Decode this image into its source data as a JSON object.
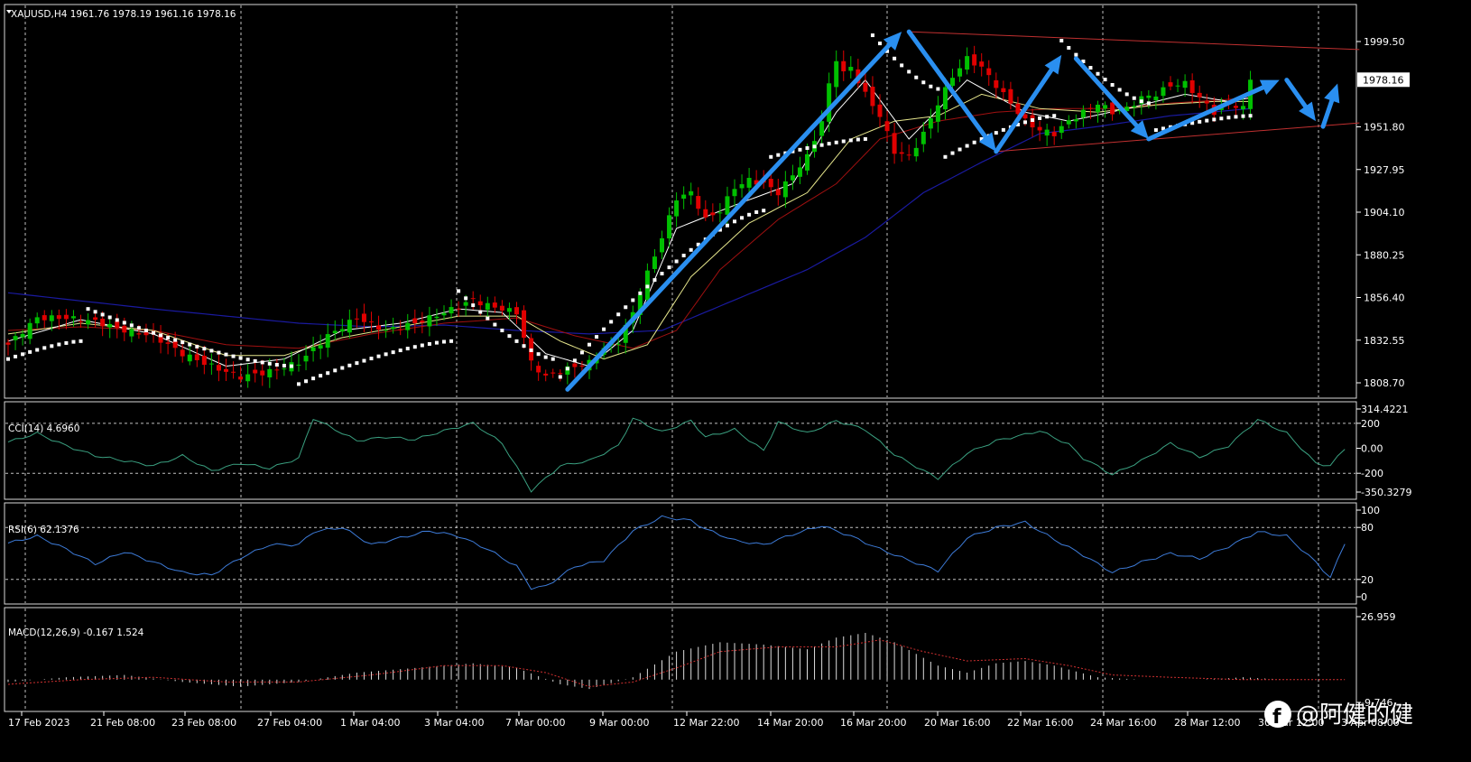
{
  "window": {
    "symbol_line": "XAUUSD,H4  1961.76 1978.19 1961.16 1978.16"
  },
  "colors": {
    "background": "#000000",
    "grid": "#ffffff",
    "bull": "#00c000",
    "bear": "#e00000",
    "ma_blue": "#1a1aa0",
    "ma_red": "#a01010",
    "ma_yellow": "#e6e68c",
    "ma_white": "#ffffff",
    "sar": "#ffffff",
    "arrows": "#2a8ff0",
    "channel": "#c03030",
    "cci": "#3aa080",
    "rsi": "#3d7bd8",
    "macd_hist": "#dddddd",
    "macd_signal": "#d03030"
  },
  "price_axis": {
    "labels": [
      "1999.50",
      "1978.16",
      "1951.80",
      "1927.95",
      "1904.10",
      "1880.25",
      "1856.40",
      "1832.55",
      "1808.70"
    ],
    "current_price": "1978.16"
  },
  "time_axis": {
    "labels": [
      "17 Feb 2023",
      "21 Feb 08:00",
      "23 Feb 08:00",
      "27 Feb 04:00",
      "1 Mar 04:00",
      "3 Mar 04:00",
      "7 Mar 00:00",
      "9 Mar 00:00",
      "12 Mar 22:00",
      "14 Mar 20:00",
      "16 Mar 20:00",
      "20 Mar 16:00",
      "22 Mar 16:00",
      "24 Mar 16:00",
      "28 Mar 12:00",
      "30 Mar 12:00",
      "3 Apr 08:00"
    ]
  },
  "cci_panel": {
    "label": "CCI(14) 4.6960",
    "axis_labels": [
      "314.4221",
      "200",
      "0.00",
      "-200",
      "-350.3279"
    ]
  },
  "rsi_panel": {
    "label": "RSI(6) 62.1376",
    "axis_labels": [
      "100",
      "80",
      "20",
      "0"
    ]
  },
  "macd_panel": {
    "label": "MACD(12,26,9) -0.167 1.524",
    "axis_labels": [
      "26.959",
      "-9.746"
    ]
  },
  "watermark": {
    "text": "@阿健的健",
    "icon": "facebook-logo-icon"
  },
  "chart_data": {
    "type": "candlestick",
    "symbol": "XAUUSD",
    "timeframe": "H4",
    "ylim": [
      1800,
      2010
    ],
    "ohlc_last": {
      "open": 1961.76,
      "high": 1978.19,
      "low": 1961.16,
      "close": 1978.16
    },
    "close_path": [
      [
        0,
        1830
      ],
      [
        4,
        1845
      ],
      [
        8,
        1845
      ],
      [
        12,
        1843
      ],
      [
        16,
        1838
      ],
      [
        20,
        1835
      ],
      [
        24,
        1825
      ],
      [
        28,
        1818
      ],
      [
        32,
        1812
      ],
      [
        36,
        1815
      ],
      [
        40,
        1820
      ],
      [
        44,
        1835
      ],
      [
        48,
        1845
      ],
      [
        52,
        1838
      ],
      [
        56,
        1842
      ],
      [
        60,
        1848
      ],
      [
        64,
        1855
      ],
      [
        66,
        1852
      ],
      [
        68,
        1850
      ],
      [
        70,
        1848
      ],
      [
        72,
        1820
      ],
      [
        74,
        1812
      ],
      [
        76,
        1815
      ],
      [
        78,
        1818
      ],
      [
        80,
        1820
      ],
      [
        82,
        1828
      ],
      [
        84,
        1832
      ],
      [
        86,
        1848
      ],
      [
        88,
        1870
      ],
      [
        90,
        1890
      ],
      [
        92,
        1912
      ],
      [
        94,
        1915
      ],
      [
        96,
        1900
      ],
      [
        98,
        1905
      ],
      [
        100,
        1918
      ],
      [
        102,
        1922
      ],
      [
        104,
        1920
      ],
      [
        106,
        1915
      ],
      [
        108,
        1925
      ],
      [
        110,
        1935
      ],
      [
        112,
        1955
      ],
      [
        113,
        1975
      ],
      [
        114,
        1990
      ],
      [
        115,
        1982
      ],
      [
        116,
        1985
      ],
      [
        118,
        1970
      ],
      [
        120,
        1958
      ],
      [
        122,
        1938
      ],
      [
        124,
        1935
      ],
      [
        126,
        1948
      ],
      [
        128,
        1965
      ],
      [
        130,
        1980
      ],
      [
        132,
        1990
      ],
      [
        134,
        1985
      ],
      [
        136,
        1975
      ],
      [
        138,
        1965
      ],
      [
        140,
        1955
      ],
      [
        142,
        1950
      ],
      [
        144,
        1948
      ],
      [
        146,
        1955
      ],
      [
        148,
        1960
      ],
      [
        150,
        1965
      ],
      [
        152,
        1960
      ],
      [
        154,
        1962
      ],
      [
        156,
        1968
      ],
      [
        158,
        1970
      ],
      [
        160,
        1975
      ],
      [
        162,
        1976
      ],
      [
        164,
        1968
      ],
      [
        166,
        1960
      ],
      [
        168,
        1965
      ],
      [
        170,
        1962
      ],
      [
        171,
        1978
      ]
    ],
    "ma_fast": [
      [
        0,
        1832
      ],
      [
        10,
        1844
      ],
      [
        20,
        1836
      ],
      [
        30,
        1818
      ],
      [
        38,
        1822
      ],
      [
        46,
        1838
      ],
      [
        54,
        1842
      ],
      [
        62,
        1850
      ],
      [
        68,
        1848
      ],
      [
        74,
        1825
      ],
      [
        80,
        1818
      ],
      [
        86,
        1838
      ],
      [
        92,
        1895
      ],
      [
        100,
        1908
      ],
      [
        108,
        1920
      ],
      [
        114,
        1960
      ],
      [
        118,
        1978
      ],
      [
        124,
        1945
      ],
      [
        132,
        1978
      ],
      [
        140,
        1960
      ],
      [
        146,
        1955
      ],
      [
        154,
        1962
      ],
      [
        162,
        1970
      ],
      [
        168,
        1966
      ],
      [
        171,
        1968
      ]
    ],
    "ma_mid": [
      [
        0,
        1836
      ],
      [
        10,
        1842
      ],
      [
        20,
        1838
      ],
      [
        30,
        1824
      ],
      [
        38,
        1824
      ],
      [
        46,
        1834
      ],
      [
        54,
        1840
      ],
      [
        62,
        1846
      ],
      [
        70,
        1846
      ],
      [
        76,
        1832
      ],
      [
        82,
        1822
      ],
      [
        88,
        1830
      ],
      [
        94,
        1868
      ],
      [
        102,
        1898
      ],
      [
        110,
        1915
      ],
      [
        116,
        1945
      ],
      [
        122,
        1955
      ],
      [
        128,
        1958
      ],
      [
        134,
        1970
      ],
      [
        142,
        1962
      ],
      [
        150,
        1960
      ],
      [
        158,
        1964
      ],
      [
        166,
        1966
      ],
      [
        171,
        1966
      ]
    ],
    "ma_slow": [
      [
        0,
        1838
      ],
      [
        10,
        1840
      ],
      [
        20,
        1838
      ],
      [
        30,
        1830
      ],
      [
        40,
        1828
      ],
      [
        50,
        1836
      ],
      [
        60,
        1842
      ],
      [
        70,
        1845
      ],
      [
        78,
        1835
      ],
      [
        86,
        1828
      ],
      [
        92,
        1838
      ],
      [
        98,
        1872
      ],
      [
        106,
        1900
      ],
      [
        114,
        1920
      ],
      [
        120,
        1945
      ],
      [
        128,
        1955
      ],
      [
        136,
        1960
      ],
      [
        144,
        1962
      ],
      [
        152,
        1962
      ],
      [
        160,
        1965
      ],
      [
        171,
        1968
      ]
    ],
    "ma_long": [
      [
        0,
        1859
      ],
      [
        20,
        1850
      ],
      [
        40,
        1842
      ],
      [
        50,
        1840
      ],
      [
        60,
        1841
      ],
      [
        70,
        1838
      ],
      [
        80,
        1836
      ],
      [
        90,
        1838
      ],
      [
        100,
        1855
      ],
      [
        110,
        1872
      ],
      [
        118,
        1890
      ],
      [
        126,
        1915
      ],
      [
        134,
        1932
      ],
      [
        142,
        1948
      ],
      [
        150,
        1952
      ],
      [
        160,
        1958
      ],
      [
        171,
        1962
      ]
    ],
    "sar_segments": [
      {
        "from": 0,
        "to": 10,
        "start": 1822,
        "end": 1832
      },
      {
        "from": 11,
        "to": 39,
        "start": 1850,
        "end": 1818
      },
      {
        "from": 40,
        "to": 61,
        "start": 1808,
        "end": 1832
      },
      {
        "from": 62,
        "to": 75,
        "start": 1860,
        "end": 1822
      },
      {
        "from": 76,
        "to": 104,
        "start": 1812,
        "end": 1905
      },
      {
        "from": 105,
        "to": 118,
        "start": 1935,
        "end": 1945
      },
      {
        "from": 119,
        "to": 128,
        "start": 2003,
        "end": 1973
      },
      {
        "from": 129,
        "to": 144,
        "start": 1935,
        "end": 1958
      },
      {
        "from": 145,
        "to": 157,
        "start": 2000,
        "end": 1965
      },
      {
        "from": 158,
        "to": 171,
        "start": 1950,
        "end": 1958
      }
    ],
    "arrows": [
      {
        "from": [
          77,
          1805
        ],
        "to": [
          123,
          2005
        ]
      },
      {
        "from": [
          124,
          2005
        ],
        "to": [
          136,
          1938
        ]
      },
      {
        "from": [
          136,
          1938
        ],
        "to": [
          145,
          1992
        ]
      },
      {
        "from": [
          147,
          1990
        ],
        "to": [
          157,
          1945
        ]
      },
      {
        "from": [
          157,
          1945
        ],
        "to": [
          175,
          1978
        ]
      },
      {
        "from": [
          176,
          1978
        ],
        "to": [
          180,
          1955
        ]
      },
      {
        "from": [
          181,
          1952
        ],
        "to": [
          183,
          1976
        ]
      }
    ],
    "channel": {
      "upper": [
        [
          124,
          2005
        ],
        [
          186,
          1995
        ]
      ],
      "lower": [
        [
          136,
          1938
        ],
        [
          186,
          1954
        ]
      ]
    },
    "cci": {
      "ylim": [
        -350.3279,
        314.4221
      ],
      "levels": [
        200,
        -200
      ],
      "values": [
        [
          0,
          50
        ],
        [
          4,
          120
        ],
        [
          8,
          20
        ],
        [
          12,
          -60
        ],
        [
          16,
          -100
        ],
        [
          20,
          -140
        ],
        [
          24,
          -60
        ],
        [
          28,
          -180
        ],
        [
          32,
          -120
        ],
        [
          36,
          -160
        ],
        [
          40,
          -80
        ],
        [
          42,
          240
        ],
        [
          48,
          60
        ],
        [
          52,
          90
        ],
        [
          56,
          70
        ],
        [
          60,
          140
        ],
        [
          64,
          200
        ],
        [
          68,
          40
        ],
        [
          72,
          -340
        ],
        [
          76,
          -140
        ],
        [
          80,
          -100
        ],
        [
          84,
          20
        ],
        [
          86,
          240
        ],
        [
          90,
          130
        ],
        [
          94,
          220
        ],
        [
          96,
          90
        ],
        [
          100,
          150
        ],
        [
          104,
          -20
        ],
        [
          106,
          210
        ],
        [
          110,
          120
        ],
        [
          114,
          220
        ],
        [
          118,
          150
        ],
        [
          122,
          -50
        ],
        [
          126,
          -180
        ],
        [
          128,
          -240
        ],
        [
          132,
          -40
        ],
        [
          136,
          60
        ],
        [
          140,
          110
        ],
        [
          142,
          140
        ],
        [
          146,
          30
        ],
        [
          148,
          -80
        ],
        [
          152,
          -210
        ],
        [
          156,
          -100
        ],
        [
          160,
          40
        ],
        [
          164,
          -70
        ],
        [
          168,
          20
        ],
        [
          172,
          230
        ],
        [
          176,
          120
        ],
        [
          180,
          -120
        ],
        [
          182,
          -140
        ],
        [
          184,
          0
        ]
      ]
    },
    "rsi": {
      "ylim": [
        0,
        100
      ],
      "levels": [
        80,
        20
      ],
      "values": [
        [
          0,
          62
        ],
        [
          4,
          70
        ],
        [
          8,
          55
        ],
        [
          12,
          38
        ],
        [
          16,
          52
        ],
        [
          20,
          40
        ],
        [
          24,
          28
        ],
        [
          28,
          25
        ],
        [
          32,
          45
        ],
        [
          36,
          60
        ],
        [
          40,
          60
        ],
        [
          42,
          75
        ],
        [
          46,
          80
        ],
        [
          50,
          60
        ],
        [
          54,
          68
        ],
        [
          58,
          76
        ],
        [
          62,
          70
        ],
        [
          66,
          55
        ],
        [
          70,
          35
        ],
        [
          72,
          10
        ],
        [
          74,
          12
        ],
        [
          78,
          35
        ],
        [
          82,
          42
        ],
        [
          86,
          76
        ],
        [
          90,
          92
        ],
        [
          94,
          88
        ],
        [
          96,
          78
        ],
        [
          100,
          65
        ],
        [
          104,
          60
        ],
        [
          108,
          72
        ],
        [
          112,
          82
        ],
        [
          116,
          70
        ],
        [
          120,
          55
        ],
        [
          124,
          42
        ],
        [
          128,
          30
        ],
        [
          132,
          68
        ],
        [
          136,
          80
        ],
        [
          140,
          86
        ],
        [
          144,
          66
        ],
        [
          148,
          48
        ],
        [
          152,
          28
        ],
        [
          156,
          40
        ],
        [
          160,
          50
        ],
        [
          164,
          44
        ],
        [
          168,
          58
        ],
        [
          172,
          75
        ],
        [
          176,
          70
        ],
        [
          180,
          40
        ],
        [
          182,
          22
        ],
        [
          184,
          62
        ]
      ]
    },
    "macd": {
      "ylim": [
        -9.746,
        26.959
      ],
      "hist": [
        [
          0,
          -1
        ],
        [
          8,
          1
        ],
        [
          16,
          2
        ],
        [
          24,
          -1
        ],
        [
          32,
          -3
        ],
        [
          40,
          -1
        ],
        [
          48,
          3
        ],
        [
          56,
          5
        ],
        [
          64,
          7
        ],
        [
          70,
          5
        ],
        [
          76,
          -2
        ],
        [
          80,
          -4
        ],
        [
          86,
          1
        ],
        [
          92,
          12
        ],
        [
          98,
          16
        ],
        [
          104,
          15
        ],
        [
          110,
          13
        ],
        [
          114,
          18
        ],
        [
          118,
          20
        ],
        [
          122,
          16
        ],
        [
          128,
          6
        ],
        [
          132,
          3
        ],
        [
          136,
          7
        ],
        [
          140,
          8
        ],
        [
          144,
          6
        ],
        [
          150,
          1
        ],
        [
          156,
          0
        ],
        [
          164,
          0
        ],
        [
          170,
          1
        ],
        [
          176,
          0
        ],
        [
          184,
          0
        ]
      ],
      "signal": [
        [
          0,
          -2
        ],
        [
          10,
          0
        ],
        [
          20,
          1
        ],
        [
          30,
          -1
        ],
        [
          40,
          -1
        ],
        [
          50,
          2
        ],
        [
          60,
          6
        ],
        [
          68,
          6
        ],
        [
          74,
          3
        ],
        [
          80,
          -3
        ],
        [
          86,
          -1
        ],
        [
          92,
          5
        ],
        [
          98,
          12
        ],
        [
          106,
          14
        ],
        [
          114,
          14
        ],
        [
          120,
          17
        ],
        [
          126,
          12
        ],
        [
          132,
          8
        ],
        [
          140,
          9
        ],
        [
          146,
          6
        ],
        [
          152,
          2
        ],
        [
          160,
          1
        ],
        [
          170,
          0
        ],
        [
          180,
          0
        ],
        [
          184,
          0
        ]
      ]
    }
  }
}
